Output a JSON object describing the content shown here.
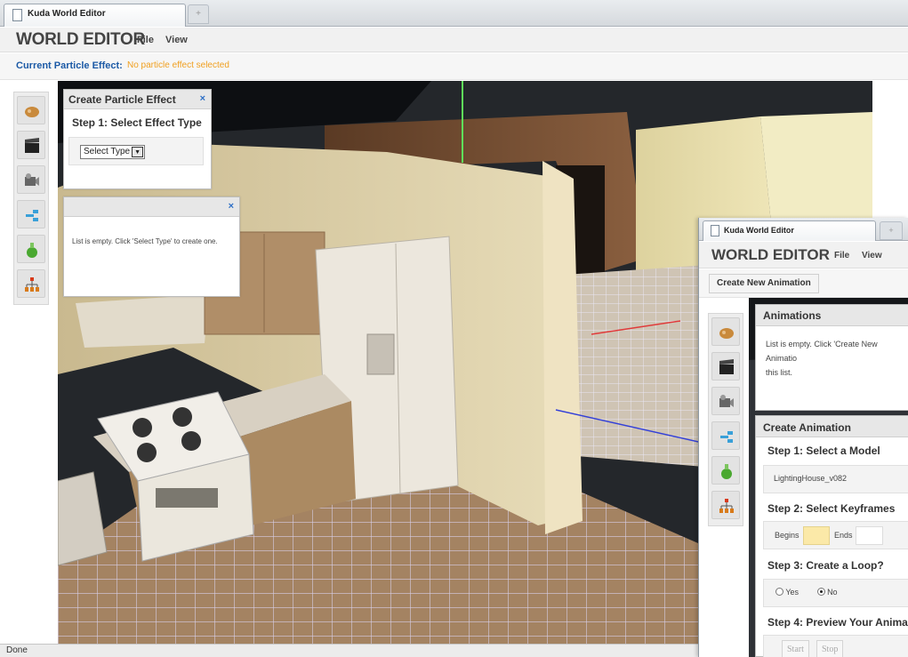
{
  "browser": {
    "tab_title": "Kuda World Editor",
    "new_tab_symbol": "+",
    "status": "Done"
  },
  "header": {
    "title": "WORLD EDITOR",
    "menu": {
      "file": "File",
      "view": "View"
    }
  },
  "current_effect": {
    "label": "Current Particle Effect:",
    "value": "No particle effect selected"
  },
  "toolbar": {
    "items": [
      {
        "icon": "hedgehog-icon"
      },
      {
        "icon": "clapperboard-icon"
      },
      {
        "icon": "video-camera-icon"
      },
      {
        "icon": "connection-icon"
      },
      {
        "icon": "potion-flask-icon"
      },
      {
        "icon": "hierarchy-icon"
      }
    ]
  },
  "create_particle": {
    "title": "Create Particle Effect",
    "close": "×",
    "step1": "Step 1: Select Effect Type",
    "select_value": "Select Type",
    "select_arrow": "▼"
  },
  "particle_list": {
    "close": "×",
    "message": "List is empty. Click 'Select Type' to create one."
  },
  "second_window": {
    "tab_title": "Kuda World Editor",
    "new_tab_symbol": "+",
    "title": "WORLD EDITOR",
    "menu": {
      "file": "File",
      "view": "View"
    },
    "create_button": "Create New Animation",
    "animations": {
      "title": "Animations",
      "message_line1": "List is empty. Click 'Create New Animatio",
      "message_line2": "this list."
    },
    "create_animation": {
      "title": "Create Animation",
      "step1": "Step 1: Select a Model",
      "model": "LightingHouse_v082",
      "step2": "Step 2: Select Keyframes",
      "begins_label": "Begins",
      "ends_label": "Ends",
      "step3": "Step 3: Create a Loop?",
      "yes": "Yes",
      "no": "No",
      "step4": "Step 4: Preview Your Anima",
      "start": "Start",
      "stop": "Stop"
    }
  },
  "colors": {
    "accent_blue": "#1c5aa6",
    "warning_orange": "#f0a020",
    "close_blue": "#2d6fc6",
    "begins_highlight": "#fbe9a8"
  }
}
